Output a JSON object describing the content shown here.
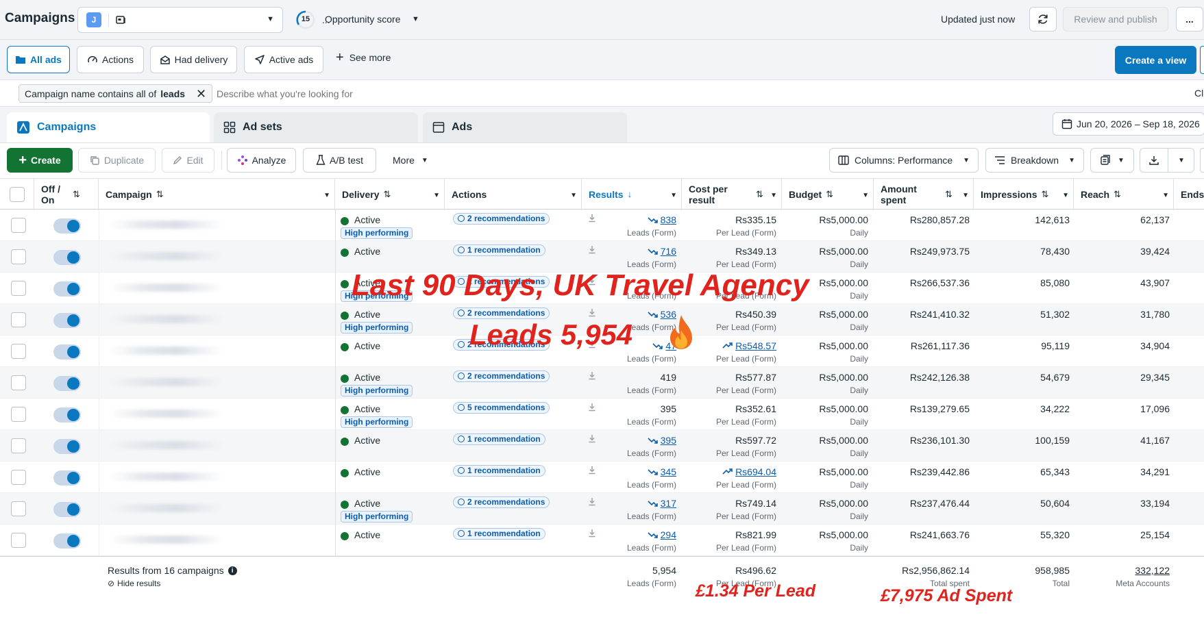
{
  "topbar": {
    "title": "Campaigns",
    "account_initial": "J",
    "account_name": "...",
    "opportunity_score_value": "15",
    "opportunity_score_label": "Opportunity score",
    "updated_text": "Updated just now",
    "review_publish_label": "Review and publish",
    "more_label": "..."
  },
  "views": {
    "items": [
      {
        "label": "All ads",
        "active": true
      },
      {
        "label": "Actions"
      },
      {
        "label": "Had delivery"
      },
      {
        "label": "Active ads"
      }
    ],
    "see_more_label": "See more",
    "create_view_label": "Create a view"
  },
  "filter": {
    "chip_prefix": "Campaign name contains all of",
    "chip_value": "leads",
    "placeholder": "Describe what you're looking for",
    "right_text": "Cl"
  },
  "tabs": [
    {
      "label": "Campaigns"
    },
    {
      "label": "Ad sets"
    },
    {
      "label": "Ads"
    }
  ],
  "date_range": "Jun 20, 2026 – Sep 18, 2026",
  "toolbar": {
    "create_label": "Create",
    "duplicate_label": "Duplicate",
    "edit_label": "Edit",
    "analyze_label": "Analyze",
    "ab_test_label": "A/B test",
    "more_label": "More",
    "columns_label": "Columns: Performance",
    "breakdown_label": "Breakdown"
  },
  "columns": {
    "off_on": "Off / On",
    "campaign": "Campaign",
    "delivery": "Delivery",
    "actions": "Actions",
    "results": "Results",
    "cost_per_result": "Cost per result",
    "budget": "Budget",
    "amount_spent": "Amount spent",
    "impressions": "Impressions",
    "reach": "Reach",
    "ends": "Ends"
  },
  "rows": [
    {
      "delivery": "Active",
      "high_performing": "High performing",
      "recommendations": "2 recommendations",
      "results": "838",
      "results_trend": true,
      "results_sub": "Leads (Form)",
      "cost": "Rs335.15",
      "cost_trend": false,
      "cost_sub": "Per Lead (Form)",
      "budget": "Rs5,000.00",
      "budget_sub": "Daily",
      "spent": "Rs280,857.28",
      "impressions": "142,613",
      "reach": "62,137"
    },
    {
      "delivery": "Active",
      "high_performing": "",
      "recommendations": "1 recommendation",
      "results": "716",
      "results_trend": true,
      "results_sub": "Leads (Form)",
      "cost": "Rs349.13",
      "cost_trend": false,
      "cost_sub": "Per Lead (Form)",
      "budget": "Rs5,000.00",
      "budget_sub": "Daily",
      "spent": "Rs249,973.75",
      "impressions": "78,430",
      "reach": "39,424"
    },
    {
      "delivery": "Active",
      "high_performing": "High performing",
      "recommendations": "2 recommendations",
      "results": "",
      "results_trend": false,
      "results_sub": "Leads (Form)",
      "cost": "",
      "cost_trend": false,
      "cost_sub": "Per Lead (Form)",
      "budget": "Rs5,000.00",
      "budget_sub": "Daily",
      "spent": "Rs266,537.36",
      "impressions": "85,080",
      "reach": "43,907"
    },
    {
      "delivery": "Active",
      "high_performing": "High performing",
      "recommendations": "2 recommendations",
      "results": "536",
      "results_trend": true,
      "results_sub": "Leads (Form)",
      "cost": "Rs450.39",
      "cost_trend": false,
      "cost_sub": "Per Lead (Form)",
      "budget": "Rs5,000.00",
      "budget_sub": "Daily",
      "spent": "Rs241,410.32",
      "impressions": "51,302",
      "reach": "31,780"
    },
    {
      "delivery": "Active",
      "high_performing": "",
      "recommendations": "2 recommendations",
      "results": "47",
      "results_trend": true,
      "results_sub": "Leads (Form)",
      "cost": "Rs548.57",
      "cost_trend": true,
      "cost_sub": "Per Lead (Form)",
      "budget": "Rs5,000.00",
      "budget_sub": "Daily",
      "spent": "Rs261,117.36",
      "impressions": "95,119",
      "reach": "34,904"
    },
    {
      "delivery": "Active",
      "high_performing": "High performing",
      "recommendations": "2 recommendations",
      "results": "419",
      "results_trend": false,
      "results_sub": "Leads (Form)",
      "cost": "Rs577.87",
      "cost_trend": false,
      "cost_sub": "Per Lead (Form)",
      "budget": "Rs5,000.00",
      "budget_sub": "Daily",
      "spent": "Rs242,126.38",
      "impressions": "54,679",
      "reach": "29,345"
    },
    {
      "delivery": "Active",
      "high_performing": "High performing",
      "recommendations": "5 recommendations",
      "results": "395",
      "results_trend": false,
      "results_sub": "Leads (Form)",
      "cost": "Rs352.61",
      "cost_trend": false,
      "cost_sub": "Per Lead (Form)",
      "budget": "Rs5,000.00",
      "budget_sub": "Daily",
      "spent": "Rs139,279.65",
      "impressions": "34,222",
      "reach": "17,096"
    },
    {
      "delivery": "Active",
      "high_performing": "",
      "recommendations": "1 recommendation",
      "results": "395",
      "results_trend": true,
      "results_sub": "Leads (Form)",
      "cost": "Rs597.72",
      "cost_trend": false,
      "cost_sub": "Per Lead (Form)",
      "budget": "Rs5,000.00",
      "budget_sub": "Daily",
      "spent": "Rs236,101.30",
      "impressions": "100,159",
      "reach": "41,167"
    },
    {
      "delivery": "Active",
      "high_performing": "",
      "recommendations": "1 recommendation",
      "results": "345",
      "results_trend": true,
      "results_sub": "Leads (Form)",
      "cost": "Rs694.04",
      "cost_trend": true,
      "cost_sub": "Per Lead (Form)",
      "budget": "Rs5,000.00",
      "budget_sub": "Daily",
      "spent": "Rs239,442.86",
      "impressions": "65,343",
      "reach": "34,291"
    },
    {
      "delivery": "Active",
      "high_performing": "High performing",
      "recommendations": "2 recommendations",
      "results": "317",
      "results_trend": true,
      "results_sub": "Leads (Form)",
      "cost": "Rs749.14",
      "cost_trend": false,
      "cost_sub": "Per Lead (Form)",
      "budget": "Rs5,000.00",
      "budget_sub": "Daily",
      "spent": "Rs237,476.44",
      "impressions": "50,604",
      "reach": "33,194"
    },
    {
      "delivery": "Active",
      "high_performing": "",
      "recommendations": "1 recommendation",
      "results": "294",
      "results_trend": true,
      "results_sub": "Leads (Form)",
      "cost": "Rs821.99",
      "cost_trend": false,
      "cost_sub": "Per Lead (Form)",
      "budget": "Rs5,000.00",
      "budget_sub": "Daily",
      "spent": "Rs241,663.76",
      "impressions": "55,320",
      "reach": "25,154"
    }
  ],
  "summary": {
    "label": "Results from 16 campaigns",
    "hide_label": "Hide results",
    "results": "5,954",
    "results_sub": "Leads (Form)",
    "cost": "Rs496.62",
    "cost_sub": "Per Lead (Form)",
    "spent": "Rs2,956,862.14",
    "spent_sub": "Total spent",
    "impressions": "958,985",
    "impressions_sub": "Total",
    "reach": "332,122",
    "reach_sub": "Meta Accounts"
  },
  "overlay": {
    "headline": "Last 90 Days, UK Travel Agency",
    "leads": "Leads 5,954",
    "per_lead": "£1.34 Per Lead",
    "ad_spent": "£7,975 Ad Spent"
  },
  "colors": {
    "primary_blue": "#0a78be",
    "create_green": "#137333",
    "overlay_red": "#e0231d"
  }
}
